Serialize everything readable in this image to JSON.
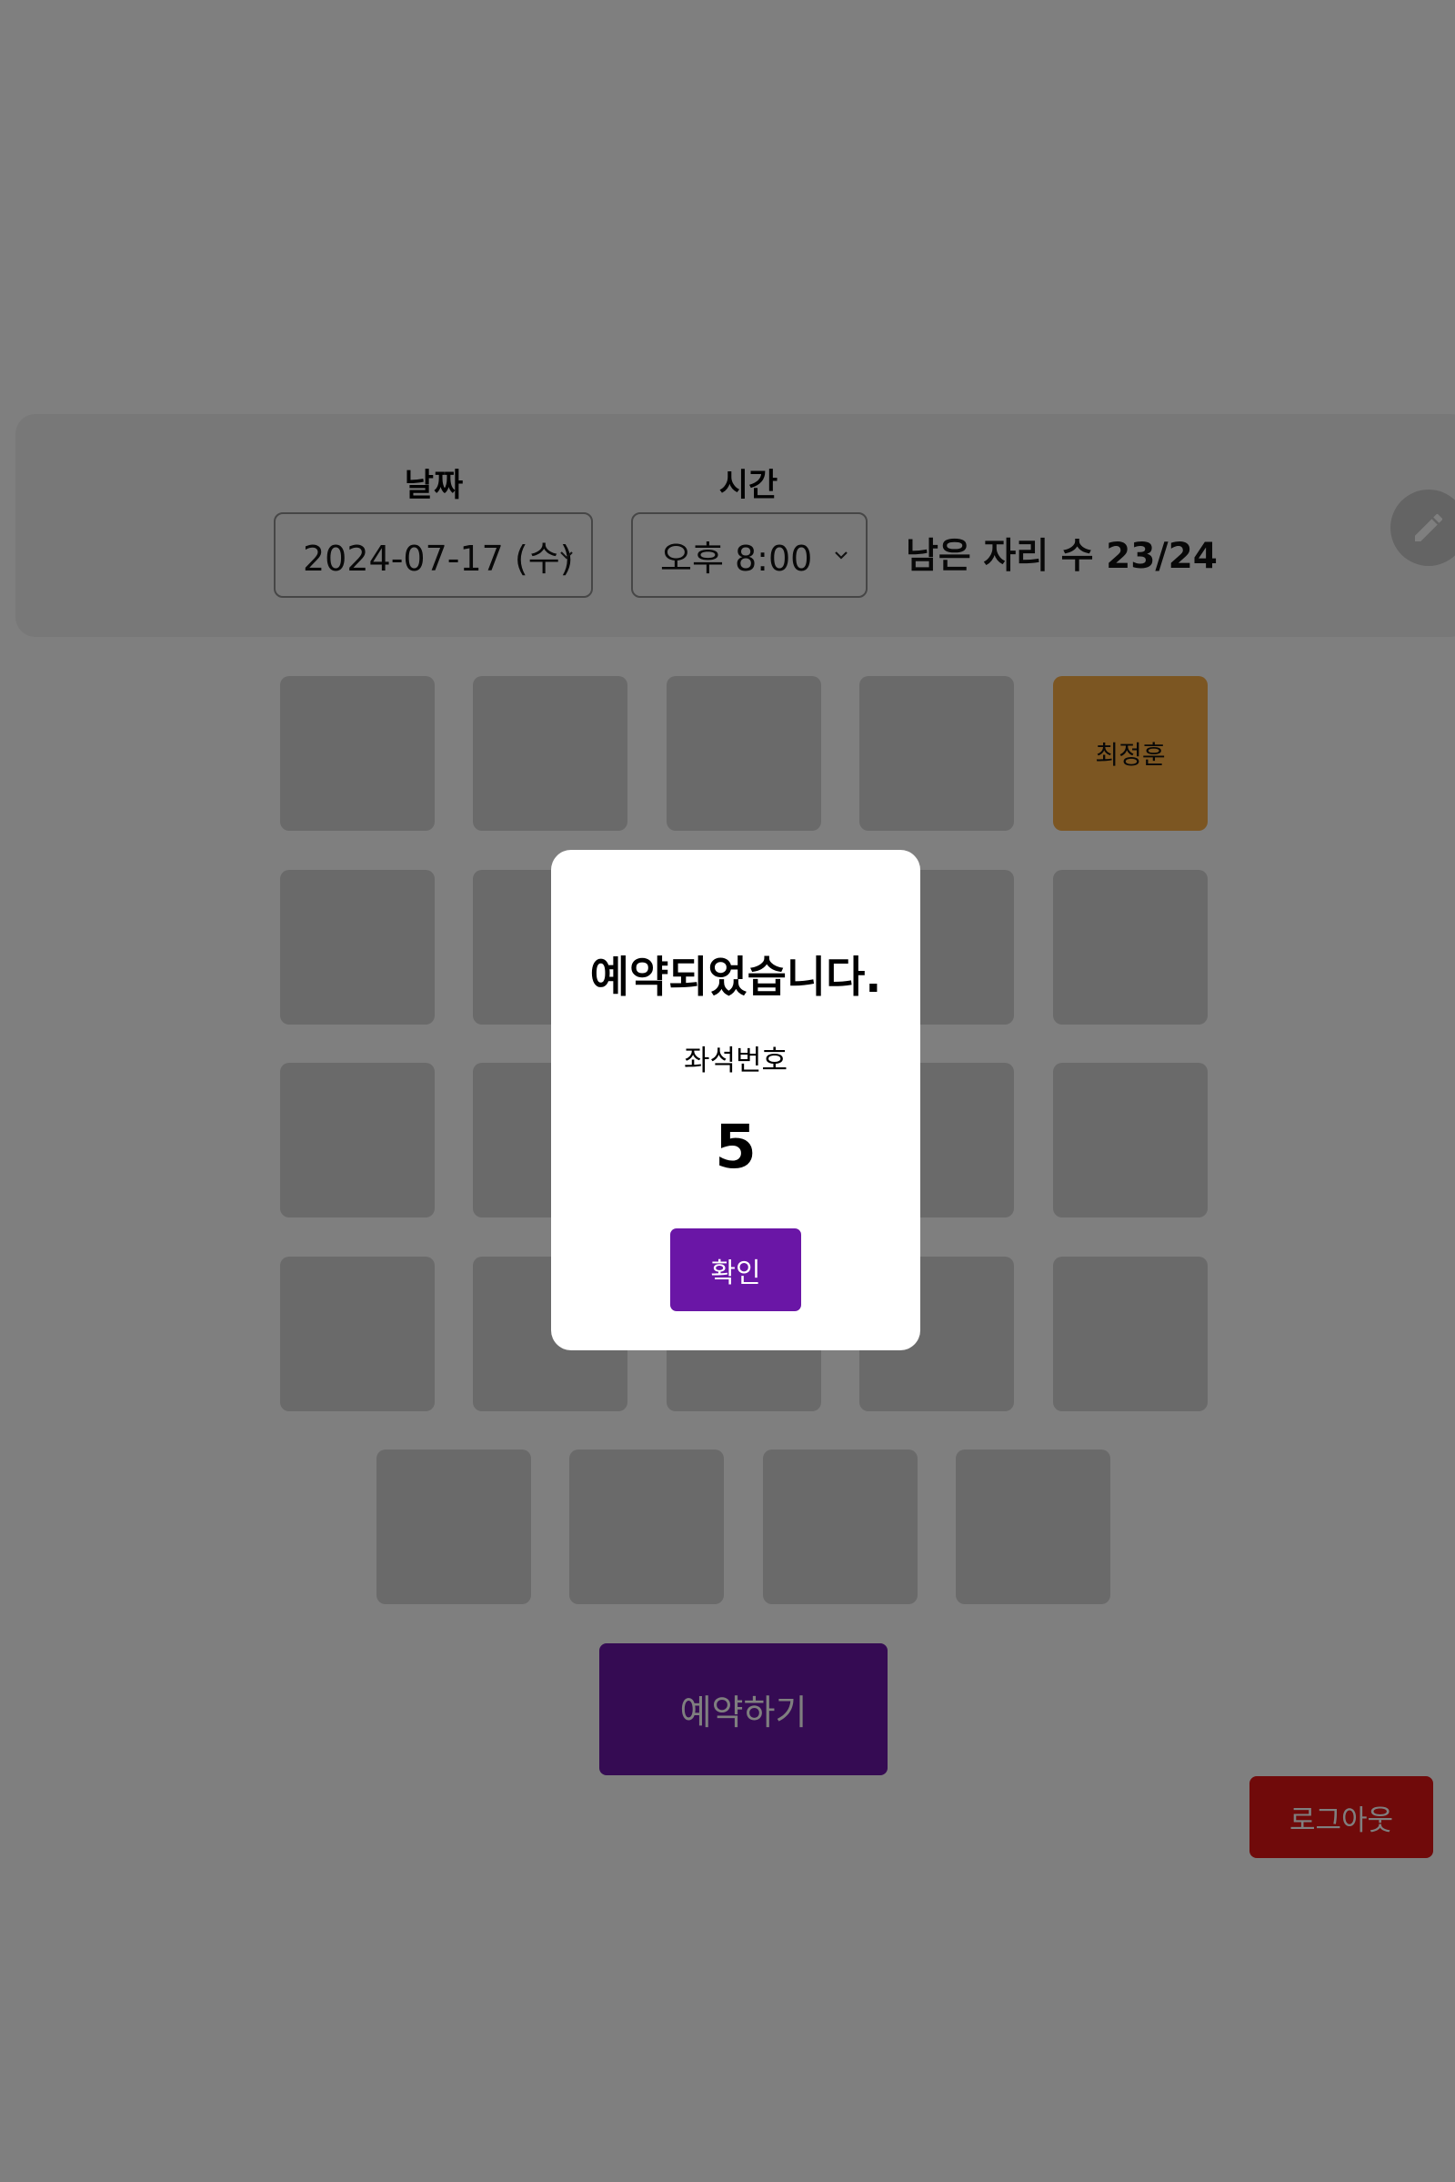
{
  "header": {
    "date_label": "날짜",
    "time_label": "시간",
    "date_value": "2024-07-17 (수)",
    "time_value": "오후 8:00",
    "remaining_seats": "남은 자리 수 23/24",
    "edit_icon": "pencil-icon",
    "chevron_icon": "chevron-down-icon"
  },
  "seats": {
    "taken_name": "최정훈",
    "taken_color": "#f8ad45",
    "empty_color": "#d4d4d4"
  },
  "actions": {
    "reserve_label": "예약하기",
    "logout_label": "로그아웃",
    "reserve_color": "#6a16a6",
    "logout_color": "#e11515"
  },
  "modal": {
    "title": "예약되었습니다.",
    "seat_caption": "좌석번호",
    "seat_number": "5",
    "ok_label": "확인"
  }
}
